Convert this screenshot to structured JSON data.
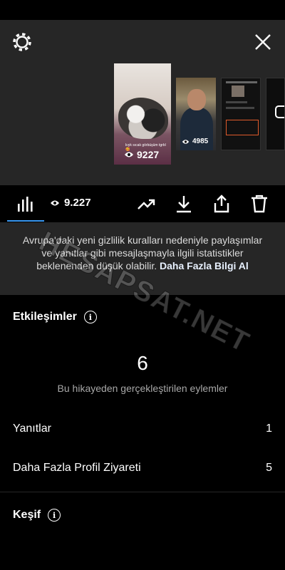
{
  "top": {
    "settings_icon": "gear-icon",
    "close_icon": "close-icon"
  },
  "thumbnails": [
    {
      "views": "9227",
      "caption": "kıyk sıcak görbüşüm tgrbl 🥰"
    },
    {
      "views": "4985"
    },
    {
      "views": ""
    },
    {
      "icon": "camera-icon"
    }
  ],
  "toolbar": {
    "insights_icon": "bar-chart-icon",
    "views_icon": "eye-icon",
    "views": "9.227",
    "promote_icon": "trending-up-icon",
    "download_icon": "download-icon",
    "share_icon": "share-icon",
    "delete_icon": "trash-icon"
  },
  "notice": {
    "text": "Avrupa'daki yeni gizlilik kuralları nedeniyle paylaşımlar ve yanıtlar gibi mesajlaşmayla ilgili istatistikler beklenenden düşük olabilir.",
    "link": "Daha Fazla Bilgi Al"
  },
  "interactions": {
    "title": "Etkileşimler",
    "total": "6",
    "subtitle": "Bu hikayeden gerçekleştirilen eylemler",
    "rows": [
      {
        "label": "Yanıtlar",
        "value": "1"
      },
      {
        "label": "Daha Fazla Profil Ziyareti",
        "value": "5"
      }
    ]
  },
  "discovery": {
    "title": "Keşif"
  },
  "watermark": "HESAPSAT.NET",
  "colors": {
    "accent": "#3897f0",
    "background": "#000000",
    "panel": "#262626"
  }
}
